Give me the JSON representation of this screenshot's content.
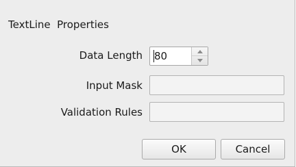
{
  "dialog": {
    "title": "TextLine  Properties"
  },
  "data_length": {
    "label": "Data Length",
    "value": "80"
  },
  "input_mask": {
    "label": "Input Mask",
    "value": ""
  },
  "validation_rules": {
    "label": "Validation Rules",
    "value": ""
  },
  "buttons": {
    "ok": "OK",
    "cancel": "Cancel"
  },
  "icons": {
    "spin_up": "chevron-up-icon",
    "spin_down": "chevron-down-icon"
  }
}
